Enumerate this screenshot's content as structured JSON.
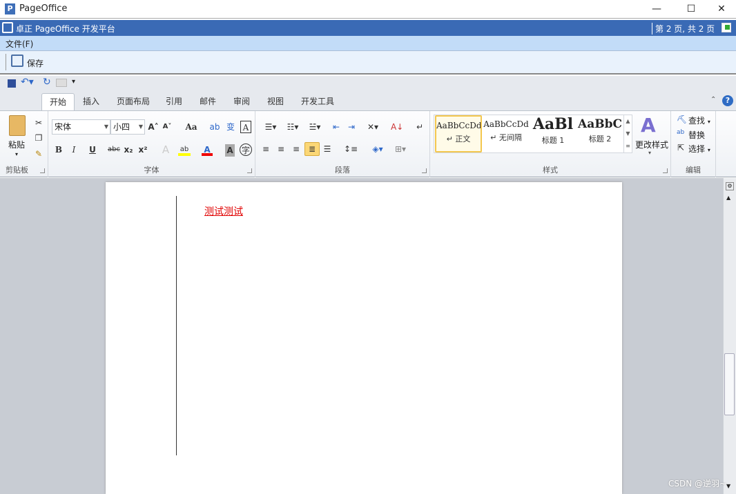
{
  "window": {
    "title": "PageOffice",
    "minimize": "—",
    "maximize": "☐",
    "close": "✕"
  },
  "header": {
    "title": "卓正 PageOffice 开发平台",
    "page_info": "第 2 页, 共 2 页"
  },
  "menu": {
    "file": "文件(F)"
  },
  "toolbar": {
    "save": "保存"
  },
  "tabs": [
    "开始",
    "插入",
    "页面布局",
    "引用",
    "邮件",
    "审阅",
    "视图",
    "开发工具"
  ],
  "ribbon": {
    "clipboard": {
      "label": "剪贴板",
      "paste": "粘贴"
    },
    "font": {
      "label": "字体",
      "font_name": "宋体",
      "font_size": "小四",
      "change_case": "Aa",
      "bold": "B",
      "italic": "I",
      "underline": "U",
      "strike": "abc",
      "subscript": "x₂",
      "superscript": "x²"
    },
    "paragraph": {
      "label": "段落"
    },
    "styles": {
      "label": "样式",
      "items": [
        {
          "preview": "AaBbCcDd",
          "name": "↵ 正文"
        },
        {
          "preview": "AaBbCcDd",
          "name": "↵ 无间隔"
        },
        {
          "preview": "AaBl",
          "name": "标题 1"
        },
        {
          "preview": "AaBbC",
          "name": "标题 2"
        }
      ],
      "change_styles": "更改样式"
    },
    "editing": {
      "label": "编辑",
      "find": "查找",
      "replace": "替换",
      "select": "选择"
    }
  },
  "document": {
    "text": "测试测试"
  },
  "watermark": "CSDN @逆羽~"
}
